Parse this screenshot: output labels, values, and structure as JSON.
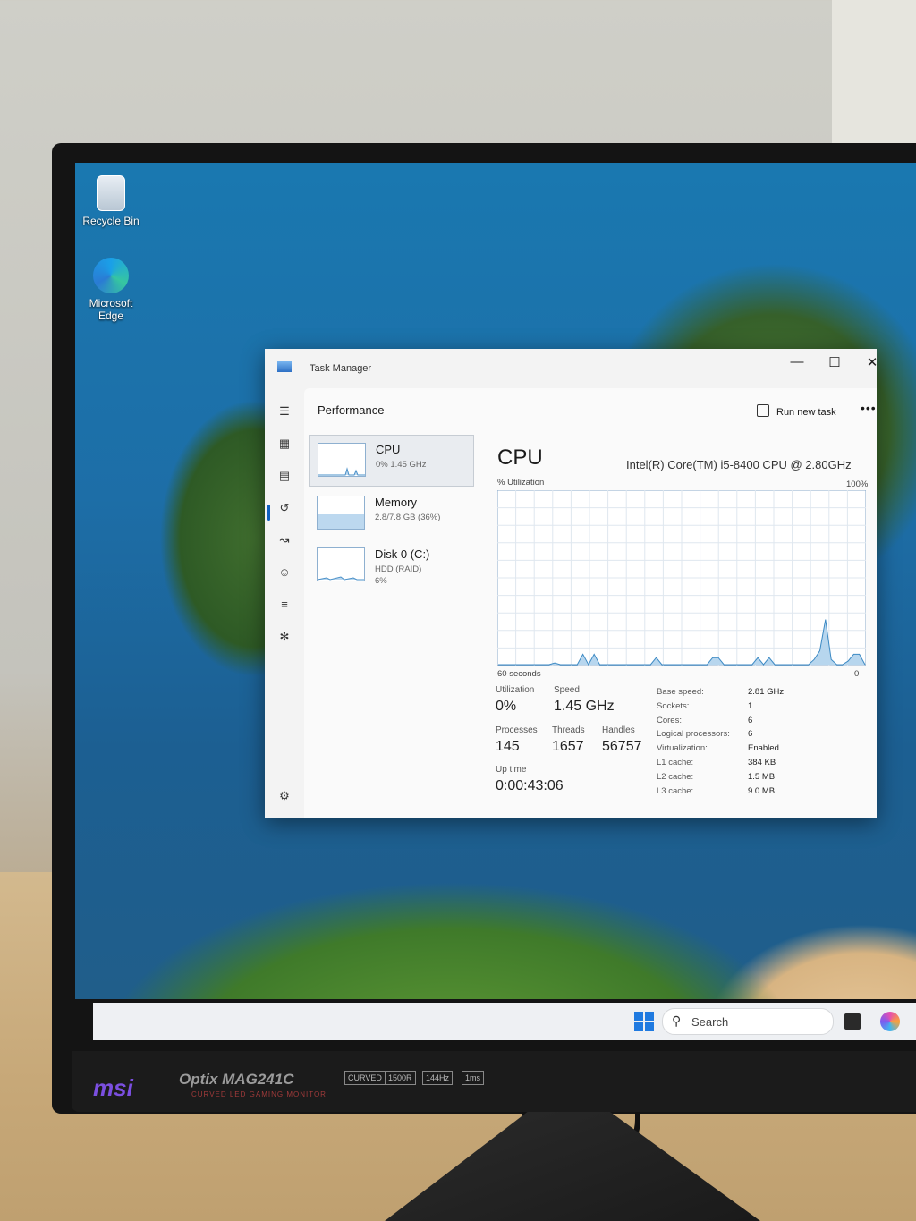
{
  "desktop": {
    "icons": [
      {
        "label": "Recycle Bin"
      },
      {
        "label": "Microsoft Edge"
      }
    ]
  },
  "taskbar": {
    "search_label": "Search"
  },
  "monitor": {
    "brand": "msi",
    "model": "Optix MAG241C",
    "model_sub": "CURVED LED GAMING MONITOR",
    "features": [
      "CURVED",
      "1500R",
      "144Hz",
      "1ms"
    ]
  },
  "task_manager": {
    "window_title": "Task Manager",
    "controls": {
      "minimize": "—",
      "maximize": "☐",
      "close": "✕"
    },
    "page_title": "Performance",
    "run_new_task": "Run new task",
    "more": "•••",
    "sidebar_icons": [
      "hamburger-icon",
      "processes-icon",
      "performance-icon",
      "app-history-icon",
      "startup-icon",
      "users-icon",
      "details-icon",
      "services-icon",
      "settings-icon"
    ],
    "resources": [
      {
        "name": "CPU",
        "sub1": "0%  1.45 GHz",
        "sub2": ""
      },
      {
        "name": "Memory",
        "sub1": "2.8/7.8 GB (36%)",
        "sub2": ""
      },
      {
        "name": "Disk 0 (C:)",
        "sub1": "HDD (RAID)",
        "sub2": "6%"
      }
    ],
    "cpu": {
      "title": "CPU",
      "model": "Intel(R) Core(TM) i5-8400 CPU @ 2.80GHz",
      "util_label": "% Utilization",
      "util_max": "100%",
      "time_label": "60 seconds",
      "time_zero": "0",
      "utilization": {
        "label": "Utilization",
        "value": "0%"
      },
      "speed": {
        "label": "Speed",
        "value": "1.45 GHz"
      },
      "processes": {
        "label": "Processes",
        "value": "145"
      },
      "threads": {
        "label": "Threads",
        "value": "1657"
      },
      "handles": {
        "label": "Handles",
        "value": "56757"
      },
      "uptime": {
        "label": "Up time",
        "value": "0:00:43:06"
      },
      "properties": [
        {
          "k": "Base speed:",
          "v": "2.81 GHz"
        },
        {
          "k": "Sockets:",
          "v": "1"
        },
        {
          "k": "Cores:",
          "v": "6"
        },
        {
          "k": "Logical processors:",
          "v": "6"
        },
        {
          "k": "Virtualization:",
          "v": "Enabled"
        },
        {
          "k": "L1 cache:",
          "v": "384 KB"
        },
        {
          "k": "L2 cache:",
          "v": "1.5 MB"
        },
        {
          "k": "L3 cache:",
          "v": "9.0 MB"
        }
      ],
      "history_percent": [
        0,
        0,
        0,
        0,
        0,
        0,
        0,
        0,
        0,
        0,
        1,
        0,
        0,
        0,
        0,
        6,
        0,
        6,
        0,
        0,
        0,
        0,
        0,
        0,
        0,
        0,
        0,
        0,
        4,
        0,
        0,
        0,
        0,
        0,
        0,
        0,
        0,
        0,
        4,
        4,
        0,
        0,
        0,
        0,
        0,
        0,
        4,
        0,
        4,
        0,
        0,
        0,
        0,
        0,
        0,
        0,
        3,
        8,
        26,
        3,
        0,
        0,
        2,
        6,
        6,
        0
      ]
    }
  }
}
